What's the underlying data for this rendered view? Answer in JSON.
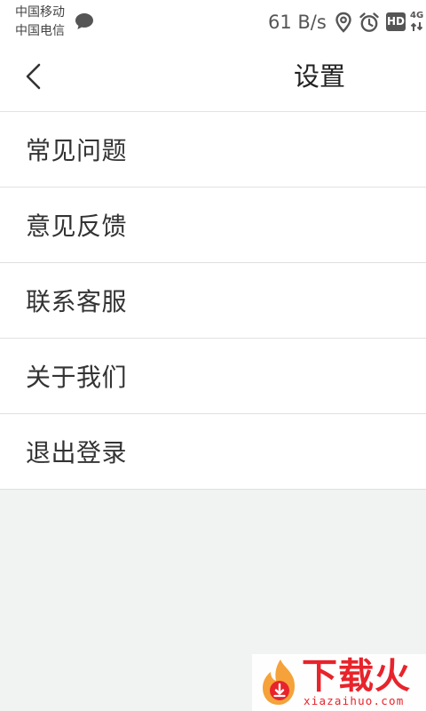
{
  "status_bar": {
    "carrier_1": "中国移动",
    "carrier_2": "中国电信",
    "net_speed": "61 B/s",
    "hd_label": "HD",
    "network_label": "4G",
    "icons": [
      "message-icon",
      "location-icon",
      "alarm-icon",
      "hd-icon",
      "signal-4g-icon"
    ]
  },
  "header": {
    "title": "设置",
    "back_icon": "chevron-left-icon"
  },
  "menu": {
    "items": [
      {
        "label": "常见问题"
      },
      {
        "label": "意见反馈"
      },
      {
        "label": "联系客服"
      },
      {
        "label": "关于我们"
      },
      {
        "label": "退出登录"
      }
    ]
  },
  "watermark": {
    "brand": "下载火",
    "url": "xiazaihuo.com"
  },
  "colors": {
    "page_background": "#f1f2f2",
    "surface": "#ffffff",
    "divider": "#e0e0e0",
    "text_primary": "#333333",
    "watermark_red": "#e8232b",
    "watermark_orange": "#f5a23a"
  }
}
